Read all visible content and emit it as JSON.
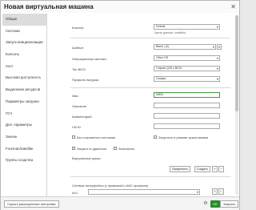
{
  "window": {
    "title": "Новая виртуальная машина",
    "close_glyph": "✕"
  },
  "sidebar": {
    "items": [
      {
        "label": "Общие",
        "active": true
      },
      {
        "label": "Система"
      },
      {
        "label": "Запуск инициализации"
      },
      {
        "label": "Консоль"
      },
      {
        "label": "Хост"
      },
      {
        "label": "Высокая доступность"
      },
      {
        "label": "Выделение ресурсов"
      },
      {
        "label": "Параметры загрузки"
      },
      {
        "label": "ГСЧ"
      },
      {
        "label": "Доп. параметры"
      },
      {
        "label": "Значок"
      },
      {
        "label": "Foreman/Satellite"
      },
      {
        "label": "Группы сходства"
      }
    ]
  },
  "form": {
    "cluster": {
      "label": "Кластер",
      "value": "Default",
      "hint": "Центр данных: localfield"
    },
    "template": {
      "label": "Шаблон",
      "value": "Blank | (0)"
    },
    "os": {
      "label": "Операционная система",
      "value": "Other OS"
    },
    "bios": {
      "label": "Тип BIOS",
      "value": "Chipset Q35 с BIOS"
    },
    "optimize": {
      "label": "Профиль нагрузки",
      "value": "Сервер"
    },
    "name": {
      "label": "Имя",
      "value": "VM01"
    },
    "description": {
      "label": "Описание",
      "value": ""
    },
    "comment": {
      "label": "Комментарий",
      "value": ""
    },
    "vm_id": {
      "label": "VM ID",
      "value": ""
    },
    "stateless": {
      "label": "Без сохранения состояния"
    },
    "start_paused": {
      "label": "Запустить в режиме приостановки"
    },
    "delete_protection": {
      "label": "Защита от удаления"
    },
    "sealed": {
      "label": "Запечатать"
    },
    "disks": {
      "label": "Виртуальные диски",
      "attach": "Прикрепить",
      "create": "Создать",
      "plus": "+",
      "minus": "−"
    },
    "nics": {
      "label": "Сетевые интерфейсы (с привязкой к vNIC профилю)",
      "item_label": "nic1",
      "plus": "+",
      "minus": "−"
    }
  },
  "icons": {
    "gear": "gear-icon",
    "caret": "chevron-down-icon"
  },
  "footer": {
    "advanced": "Скрыть расширенные настройки",
    "ok": "OK",
    "cancel": "Закрыть"
  },
  "colors": {
    "accent": "#2a8b2a",
    "focus_border": "#3c9c3c",
    "active_item": "#dcdcdc"
  }
}
